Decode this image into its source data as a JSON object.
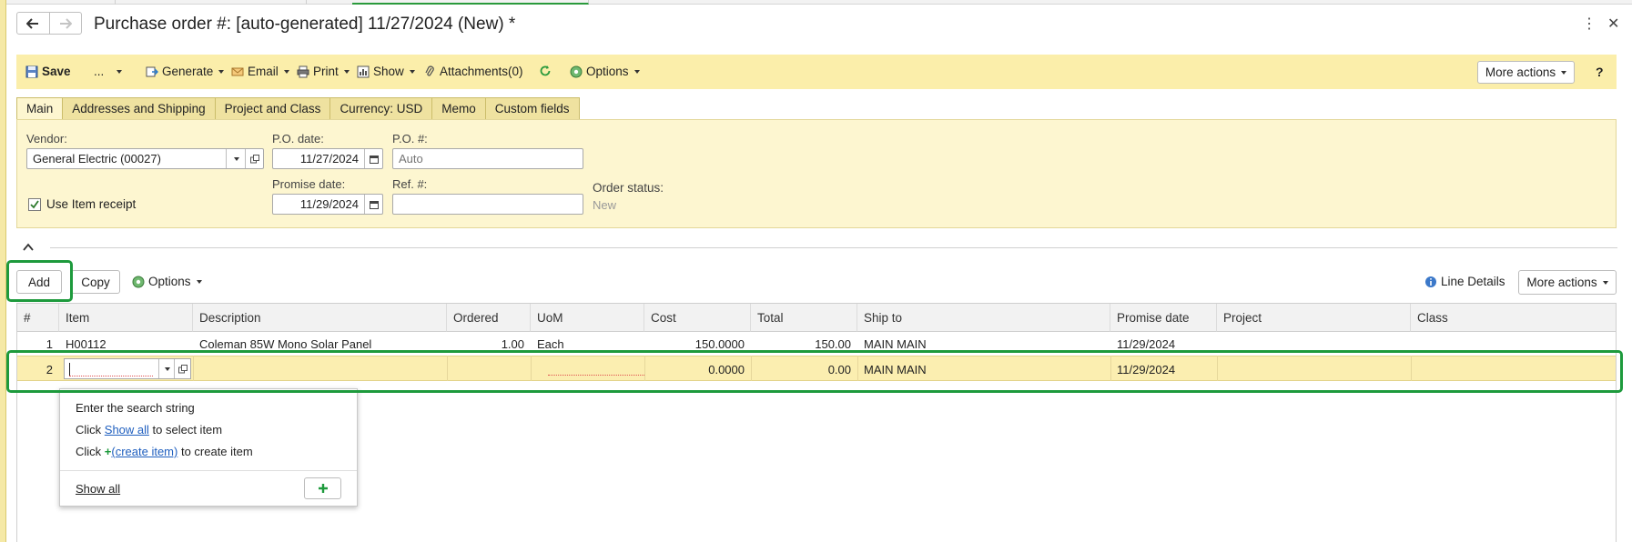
{
  "window": {
    "title": "Purchase order #: [auto-generated] 11/27/2024 (New) *",
    "back_icon": "arrow-left-icon",
    "forward_icon": "arrow-right-icon"
  },
  "toolbar": {
    "save_label": "Save",
    "more_label": "...",
    "generate_label": "Generate",
    "email_label": "Email",
    "print_label": "Print",
    "show_label": "Show",
    "attachments_label": "Attachments(0)",
    "options_label": "Options",
    "more_actions_label": "More actions",
    "help_label": "?"
  },
  "tabs": [
    {
      "label": "Main"
    },
    {
      "label": "Addresses and Shipping"
    },
    {
      "label": "Project and Class"
    },
    {
      "label": "Currency: USD"
    },
    {
      "label": "Memo"
    },
    {
      "label": "Custom fields"
    }
  ],
  "form": {
    "vendor_label": "Vendor:",
    "vendor_value": "General Electric (00027)",
    "po_date_label": "P.O. date:",
    "po_date_value": "11/27/2024",
    "po_number_label": "P.O. #:",
    "po_number_placeholder": "Auto",
    "use_item_receipt_label": "Use Item receipt",
    "use_item_receipt_checked": true,
    "promise_date_label": "Promise date:",
    "promise_date_value": "11/29/2024",
    "ref_label": "Ref. #:",
    "ref_value": "",
    "order_status_label": "Order status:",
    "order_status_value": "New"
  },
  "grid_toolbar": {
    "add_label": "Add",
    "copy_label": "Copy",
    "options_label": "Options",
    "line_details_label": "Line Details",
    "more_actions_label": "More actions"
  },
  "grid": {
    "columns": [
      "#",
      "Item",
      "Description",
      "Ordered",
      "UoM",
      "Cost",
      "Total",
      "Ship to",
      "Promise date",
      "Project",
      "Class"
    ],
    "rows": [
      {
        "num": "1",
        "item": "H00112",
        "description": "Coleman 85W Mono Solar Panel",
        "ordered": "1.00",
        "uom": "Each",
        "cost": "150.0000",
        "total": "150.00",
        "ship_to": "MAIN MAIN",
        "promise_date": "11/29/2024",
        "project": "",
        "class": ""
      },
      {
        "num": "2",
        "item": "",
        "description": "",
        "ordered": "",
        "uom": "",
        "cost": "0.0000",
        "total": "0.00",
        "ship_to": "MAIN MAIN",
        "promise_date": "11/29/2024",
        "project": "",
        "class": ""
      }
    ]
  },
  "item_popup": {
    "line1": "Enter the search string",
    "line2_prefix": "Click ",
    "line2_link": "Show all",
    "line2_suffix": " to select item",
    "line3_prefix": "Click ",
    "line3_link": "(create item)",
    "line3_suffix": " to create item",
    "footer_link": "Show all"
  },
  "colors": {
    "accent_green": "#1d9a3c",
    "toolbar_yellow": "#fbeeaa",
    "form_yellow": "#fdf6d0",
    "link_blue": "#1f5fbf"
  }
}
